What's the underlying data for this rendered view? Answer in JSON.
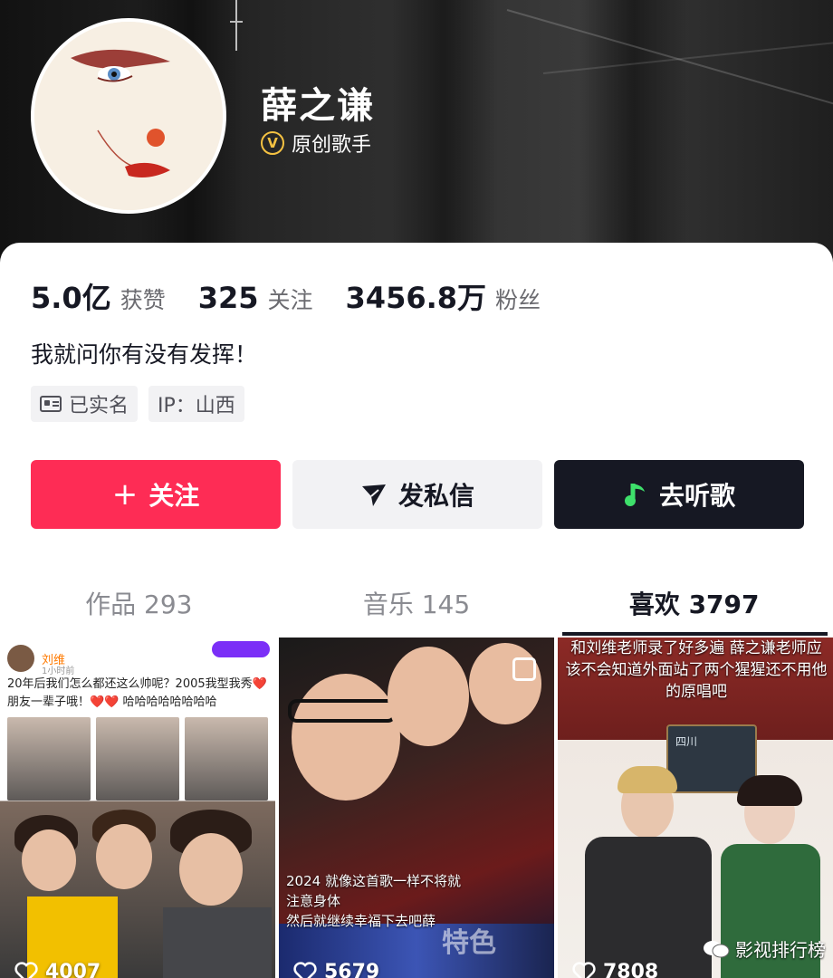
{
  "profile": {
    "name": "薛之谦",
    "verify_label": "原创歌手",
    "stats": [
      {
        "value": "5.0亿",
        "label": "获赞"
      },
      {
        "value": "325",
        "label": "关注"
      },
      {
        "value": "3456.8万",
        "label": "粉丝"
      }
    ],
    "bio": "我就问你有没有发挥！",
    "tags": [
      "已实名",
      "IP：山西"
    ]
  },
  "actions": {
    "follow": "关注",
    "message": "发私信",
    "music": "去听歌"
  },
  "tabs": [
    {
      "label": "作品 293",
      "active": false
    },
    {
      "label": "音乐 145",
      "active": false
    },
    {
      "label": "喜欢 3797",
      "active": true
    }
  ],
  "grid": [
    {
      "post_name": "刘维",
      "post_time": "1小时前",
      "post_text": "20年后我们怎么都还这么帅呢？2005我型我秀❤️朋友一辈子哦！❤️❤️ 哈哈哈哈哈哈哈哈",
      "count": "4007"
    },
    {
      "caption_line1": "2024 就像这首歌一样不将就",
      "caption_line2": "注意身体",
      "caption_line3": "然后就继续幸福下去吧薛",
      "bottom_text": "特色",
      "count": "5679"
    },
    {
      "caption": "和刘维老师录了好多遍 薛之谦老师应该不会知道外面站了两个猩猩还不用他的原唱吧",
      "board_text": "四川",
      "count": "7808",
      "watermark": "影视排行榜"
    }
  ],
  "colors": {
    "follow": "#fe2c55",
    "music_button": "#161823",
    "verify": "#f5c242",
    "music_icon": "#3ee06b"
  }
}
